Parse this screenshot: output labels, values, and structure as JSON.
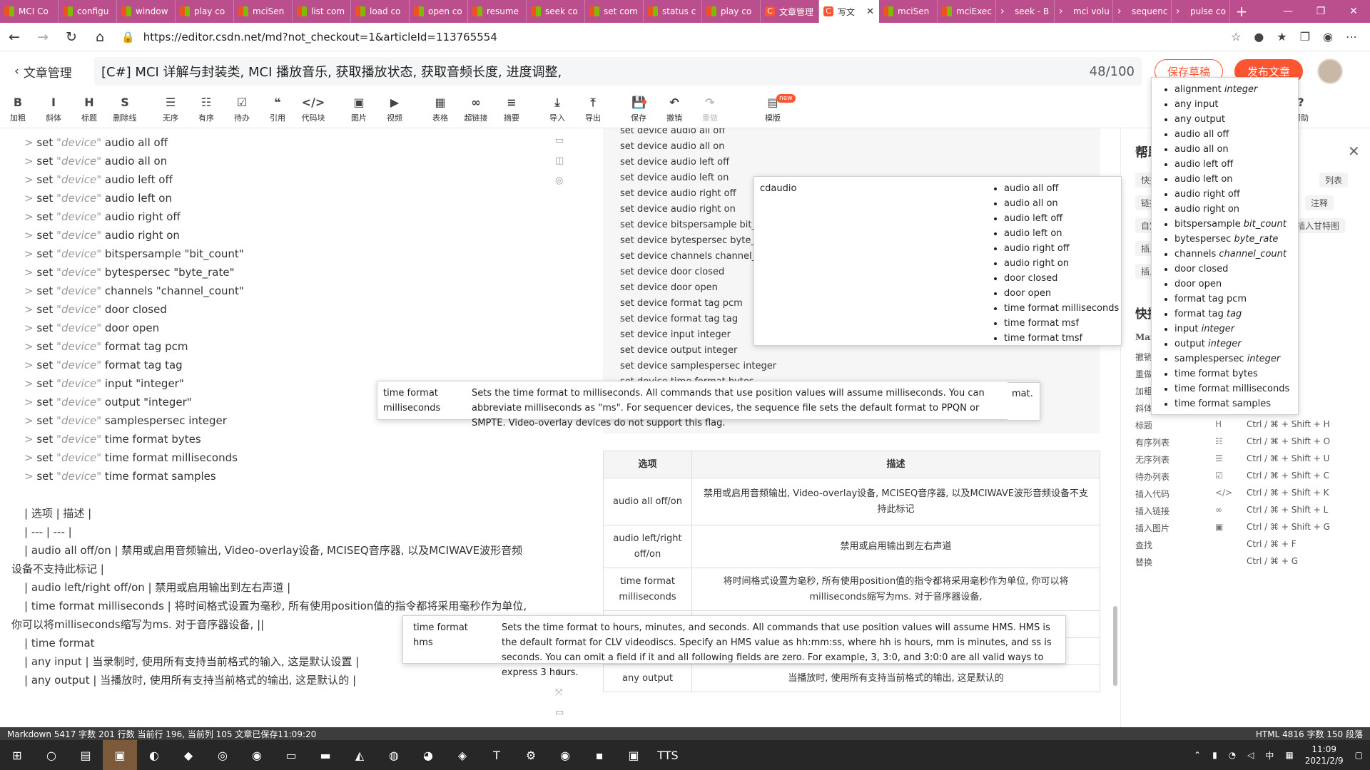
{
  "browser": {
    "tabs": [
      {
        "label": "MCI Co",
        "fav": "ms"
      },
      {
        "label": "configu",
        "fav": "ms"
      },
      {
        "label": "window",
        "fav": "ms"
      },
      {
        "label": "play co",
        "fav": "ms"
      },
      {
        "label": "mciSen",
        "fav": "ms"
      },
      {
        "label": "list com",
        "fav": "ms"
      },
      {
        "label": "load co",
        "fav": "ms"
      },
      {
        "label": "open co",
        "fav": "ms"
      },
      {
        "label": "resume",
        "fav": "ms"
      },
      {
        "label": "seek co",
        "fav": "ms"
      },
      {
        "label": "set com",
        "fav": "ms"
      },
      {
        "label": "status c",
        "fav": "ms"
      },
      {
        "label": "play co",
        "fav": "ms"
      },
      {
        "label": "文章管理",
        "fav": "csdn"
      },
      {
        "label": "写文",
        "fav": "csdn",
        "active": true
      },
      {
        "label": "mciSen",
        "fav": "ms"
      },
      {
        "label": "mciExec",
        "fav": "ms"
      },
      {
        "label": "seek - B",
        "fav": "ps"
      },
      {
        "label": "mci volu",
        "fav": "ps"
      },
      {
        "label": "sequenc",
        "fav": "ps"
      },
      {
        "label": "pulse co",
        "fav": "ps"
      }
    ],
    "url": "https://editor.csdn.net/md?not_checkout=1&articleId=113765554"
  },
  "editor": {
    "back_label": "文章管理",
    "title": "[C#] MCI 详解与封装类, MCI 播放音乐, 获取播放状态, 获取音频长度, 进度调整,",
    "title_count": "48/100",
    "save_draft": "保存草稿",
    "publish": "发布文章",
    "new_badge": "new"
  },
  "toolbar": [
    {
      "icon": "B",
      "label": "加粗",
      "name": "bold"
    },
    {
      "icon": "I",
      "label": "斜体",
      "name": "italic"
    },
    {
      "icon": "H",
      "label": "标题",
      "name": "heading"
    },
    {
      "icon": "S",
      "label": "删除线",
      "name": "strikethrough"
    },
    {
      "icon": "☰",
      "label": "无序",
      "name": "unordered-list"
    },
    {
      "icon": "☷",
      "label": "有序",
      "name": "ordered-list"
    },
    {
      "icon": "☑",
      "label": "待办",
      "name": "todo"
    },
    {
      "icon": "❝",
      "label": "引用",
      "name": "quote"
    },
    {
      "icon": "</>",
      "label": "代码块",
      "name": "code-block"
    },
    {
      "icon": "▣",
      "label": "图片",
      "name": "image"
    },
    {
      "icon": "▶",
      "label": "视频",
      "name": "video"
    },
    {
      "icon": "▦",
      "label": "表格",
      "name": "table"
    },
    {
      "icon": "∞",
      "label": "超链接",
      "name": "link"
    },
    {
      "icon": "≡",
      "label": "摘要",
      "name": "summary"
    },
    {
      "icon": "⤓",
      "label": "导入",
      "name": "import"
    },
    {
      "icon": "⤒",
      "label": "导出",
      "name": "export"
    },
    {
      "icon": "💾",
      "label": "保存",
      "name": "save"
    },
    {
      "icon": "↶",
      "label": "撤销",
      "name": "undo"
    },
    {
      "icon": "↷",
      "label": "重做",
      "name": "redo"
    },
    {
      "icon": "▤",
      "label": "模版",
      "name": "template"
    },
    {
      "icon": "▢",
      "label": "目录",
      "name": "toc"
    },
    {
      "icon": "?",
      "label": "帮助",
      "name": "help"
    }
  ],
  "markdown": [
    [
      ">",
      " set ",
      "\"device\"",
      " audio all off"
    ],
    [
      ">",
      " set ",
      "\"device\"",
      " audio all on"
    ],
    [
      ">",
      " set ",
      "\"device\"",
      " audio left off"
    ],
    [
      ">",
      " set ",
      "\"device\"",
      " audio left on"
    ],
    [
      ">",
      " set ",
      "\"device\"",
      " audio right off"
    ],
    [
      ">",
      " set ",
      "\"device\"",
      " audio right on"
    ],
    [
      ">",
      " set ",
      "\"device\"",
      " bitspersample \"bit_count\""
    ],
    [
      ">",
      " set ",
      "\"device\"",
      " bytespersec \"byte_rate\""
    ],
    [
      ">",
      " set ",
      "\"device\"",
      " channels \"channel_count\""
    ],
    [
      ">",
      " set ",
      "\"device\"",
      " door closed"
    ],
    [
      ">",
      " set ",
      "\"device\"",
      " door open"
    ],
    [
      ">",
      " set ",
      "\"device\"",
      " format tag pcm"
    ],
    [
      ">",
      " set ",
      "\"device\"",
      " format tag tag"
    ],
    [
      ">",
      " set ",
      "\"device\"",
      " input \"integer\""
    ],
    [
      ">",
      " set ",
      "\"device\"",
      " output \"integer\""
    ],
    [
      ">",
      " set ",
      "\"device\"",
      " samplespersec integer"
    ],
    [
      ">",
      " set ",
      "\"device\"",
      " time format bytes"
    ],
    [
      ">",
      " set ",
      "\"device\"",
      " time format milliseconds"
    ],
    [
      ">",
      " set ",
      "\"device\"",
      " time format samples"
    ]
  ],
  "markdown_table": [
    "| 选项 | 描述 |",
    "| --- | --- |",
    "| audio all off/on | 禁用或启用音频输出, Video-overlay设备, MCISEQ音序器, 以及MCIWAVE波形音频",
    "设备不支持此标记 |",
    "| audio left/right off/on | 禁用或启用输出到左右声道 |",
    "| time format milliseconds | 将时间格式设置为毫秒, 所有使用position值的指令都将采用毫秒作为单位,",
    "你可以将milliseconds缩写为ms. 对于音序器设备, ||",
    "| time format",
    "| any input | 当录制时, 使用所有支持当前格式的输入, 这是默认设置 |",
    "| any output | 当播放时, 使用所有支持当前格式的输出, 这是默认的 |"
  ],
  "preview_code": [
    "set device audio all off",
    "set device audio all on",
    "set device audio left off",
    "set device audio left on",
    "set device audio right off",
    "set device audio right on",
    "set device bitspersample bit_c",
    "set device bytespersec byte_r",
    "set device channels channel_c",
    "set device door closed",
    "set device door open",
    "set device format tag pcm",
    "set device format tag tag",
    "set device input integer",
    "set device output integer",
    "set device samplespersec integer",
    "set device time format bytes"
  ],
  "preview_table": {
    "headers": [
      "选项",
      "描述"
    ],
    "rows": [
      [
        "audio all off/on",
        "禁用或启用音频输出, Video-overlay设备, MCISEQ音序器, 以及MCIWAVE波形音频设备不支持此标记"
      ],
      [
        "audio left/right off/on",
        "禁用或启用输出到左右声道"
      ],
      [
        "time format milliseconds",
        "将时间格式设置为毫秒, 所有使用position值的指令都将采用毫秒作为单位, 你可以将milliseconds缩写为ms. 对于音序器设备,"
      ],
      [
        "",
        ""
      ],
      [
        "",
        ""
      ],
      [
        "any output",
        "当播放时, 使用所有支持当前格式的输出, 这是默认的"
      ]
    ]
  },
  "help": {
    "title": "帮助",
    "chips": [
      "快捷",
      "式",
      "列表",
      "链接",
      "注释",
      "自定",
      "插入甘特图",
      "插入",
      "插入"
    ],
    "shortcut_title": "快捷",
    "markdown_label": "Mar",
    "shortcuts": [
      {
        "name": "撤销",
        "icon": "",
        "key": ""
      },
      {
        "name": "重做",
        "icon": "",
        "key": ""
      },
      {
        "name": "加粗",
        "icon": "",
        "key": ""
      },
      {
        "name": "斜体",
        "icon": "",
        "key": ""
      },
      {
        "name": "标题",
        "icon": "H",
        "key": "Ctrl / ⌘ + Shift + H"
      },
      {
        "name": "有序列表",
        "icon": "☷",
        "key": "Ctrl / ⌘ + Shift + O"
      },
      {
        "name": "无序列表",
        "icon": "☰",
        "key": "Ctrl / ⌘ + Shift + U"
      },
      {
        "name": "待办列表",
        "icon": "☑",
        "key": "Ctrl / ⌘ + Shift + C"
      },
      {
        "name": "插入代码",
        "icon": "</>",
        "key": "Ctrl / ⌘ + Shift + K"
      },
      {
        "name": "插入链接",
        "icon": "∞",
        "key": "Ctrl / ⌘ + Shift + L"
      },
      {
        "name": "插入图片",
        "icon": "▣",
        "key": "Ctrl / ⌘ + Shift + G"
      },
      {
        "name": "查找",
        "icon": "",
        "key": "Ctrl / ⌘ + F"
      },
      {
        "name": "替换",
        "icon": "",
        "key": "Ctrl / ⌘ + G"
      }
    ]
  },
  "popups": {
    "cdaudio": {
      "term": "cdaudio",
      "items": [
        "audio all off",
        "audio all on",
        "audio left off",
        "audio left on",
        "audio right off",
        "audio right on",
        "door closed",
        "door open",
        "time format milliseconds",
        "time format msf",
        "time format tmsf"
      ]
    },
    "flags": {
      "items": [
        [
          "alignment ",
          "integer"
        ],
        [
          "any input",
          ""
        ],
        [
          "any output",
          ""
        ],
        [
          "audio all off",
          ""
        ],
        [
          "audio all on",
          ""
        ],
        [
          "audio left off",
          ""
        ],
        [
          "audio left on",
          ""
        ],
        [
          "audio right off",
          ""
        ],
        [
          "audio right on",
          ""
        ],
        [
          "bitspersample ",
          "bit_count"
        ],
        [
          "bytespersec ",
          "byte_rate"
        ],
        [
          "channels ",
          "channel_count"
        ],
        [
          "door closed",
          ""
        ],
        [
          "door open",
          ""
        ],
        [
          "format tag pcm",
          ""
        ],
        [
          "format tag ",
          "tag"
        ],
        [
          "input ",
          "integer"
        ],
        [
          "output ",
          "integer"
        ],
        [
          "samplespersec ",
          "integer"
        ],
        [
          "time format bytes",
          ""
        ],
        [
          "time format milliseconds",
          ""
        ],
        [
          "time format samples",
          ""
        ]
      ]
    },
    "ms": {
      "term": "time format milliseconds",
      "desc": "Sets the time format to milliseconds. All commands that use position values will assume milliseconds. You can abbreviate milliseconds as \"ms\". For sequencer devices, the sequence file sets the default format to PPQN or SMPTE. Video-overlay devices do not support this flag.",
      "tail": "mat."
    },
    "hms": {
      "term": "time format hms",
      "desc": "Sets the time format to hours, minutes, and seconds. All commands that use position values will assume HMS. HMS is the default format for CLV videodiscs. Specify an HMS value as hh:mm:ss, where hh is hours, mm is minutes, and ss is seconds. You can omit a field if it and all following fields are zero. For example, 3, 3:0, and 3:0:0 are all valid ways to express 3 hours."
    }
  },
  "status": {
    "left": "Markdown  5417 字数  201 行数  当前行 196, 当前列 105  文章已保存11:09:20",
    "right": "HTML  4816 字数  150 段落"
  },
  "taskbar": {
    "time": "11:09",
    "date": "2021/2/9",
    "ime": "中"
  },
  "colors": {
    "tab_bar": "#bb4e8c",
    "accent": "#fc5531",
    "status_bar": "#3d3d3d",
    "taskbar": "#272727"
  }
}
